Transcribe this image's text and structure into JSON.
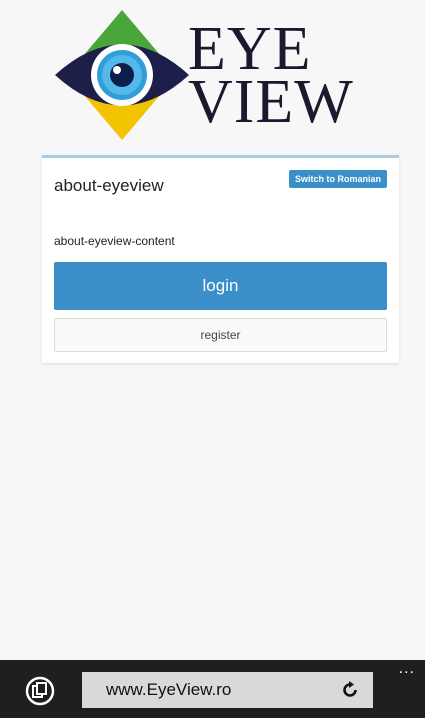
{
  "logo": {
    "line1": "EYE",
    "line2": "VIEW",
    "colors": {
      "top": "#4aa63a",
      "bottom": "#f2c300",
      "eye_dark": "#1d1f4a",
      "iris": "#2f9fd8",
      "pupil": "#0b1f4a"
    }
  },
  "card": {
    "title": "about-eyeview",
    "lang_button": "Switch to Romanian",
    "content": "about-eyeview-content",
    "login_label": "login",
    "register_label": "register",
    "accent": "#3a8fc9"
  },
  "browser": {
    "url": "www.EyeView.ro",
    "more_glyph": "...",
    "tabs_icon": "tabs-icon",
    "refresh_icon": "refresh-icon"
  }
}
